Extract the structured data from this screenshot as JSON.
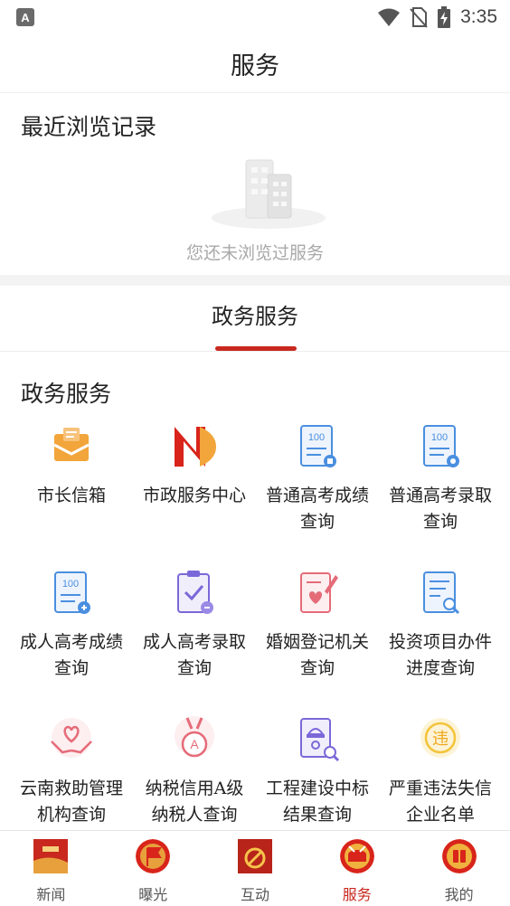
{
  "status_bar": {
    "left_icon_letter": "A",
    "time": "3:35"
  },
  "header": {
    "title": "服务"
  },
  "recent": {
    "title": "最近浏览记录",
    "empty_text": "您还未浏览过服务"
  },
  "tabs": [
    {
      "label": "政务服务",
      "active": true
    }
  ],
  "section": {
    "title": "政务服务"
  },
  "services": [
    {
      "label": "市长信箱",
      "icon": "mailbox-icon"
    },
    {
      "label": "市政服务中心",
      "icon": "service-center-logo-icon"
    },
    {
      "label": "普通高考成绩查询",
      "icon": "exam-score-icon"
    },
    {
      "label": "普通高考录取查询",
      "icon": "exam-admission-icon"
    },
    {
      "label": "成人高考成绩查询",
      "icon": "adult-exam-score-icon"
    },
    {
      "label": "成人高考录取查询",
      "icon": "adult-exam-admission-icon"
    },
    {
      "label": "婚姻登记机关查询",
      "icon": "marriage-registration-icon"
    },
    {
      "label": "投资项目办件进度查询",
      "icon": "investment-progress-icon"
    },
    {
      "label": "云南救助管理机构查询",
      "icon": "rescue-hands-heart-icon"
    },
    {
      "label": "纳税信用A级纳税人查询",
      "icon": "tax-credit-medal-icon"
    },
    {
      "label": "工程建设中标结果查询",
      "icon": "construction-bid-icon"
    },
    {
      "label": "严重违法失信企业名单",
      "icon": "violation-badge-icon"
    }
  ],
  "bottom_nav": [
    {
      "label": "新闻",
      "icon": "news-icon",
      "active": false
    },
    {
      "label": "曝光",
      "icon": "exposure-flag-icon",
      "active": false
    },
    {
      "label": "互动",
      "icon": "interaction-icon",
      "active": false
    },
    {
      "label": "服务",
      "icon": "service-drum-icon",
      "active": true
    },
    {
      "label": "我的",
      "icon": "profile-icon",
      "active": false
    }
  ],
  "colors": {
    "accent": "#c8281e",
    "icon_blue": "#4a8fe0",
    "icon_purple": "#7b68d8",
    "icon_orange": "#f2a53a",
    "icon_pink": "#e56b78",
    "icon_yellow": "#f3c43a",
    "muted_text": "#a8a8a8"
  }
}
